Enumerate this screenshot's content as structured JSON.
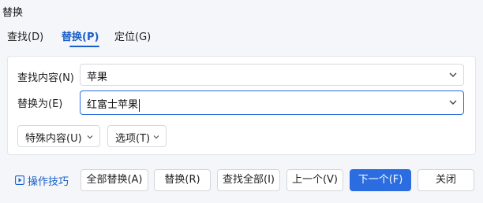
{
  "window": {
    "title": "替换"
  },
  "tabs": [
    {
      "label": "查找(D)",
      "active": false
    },
    {
      "label": "替换(P)",
      "active": true
    },
    {
      "label": "定位(G)",
      "active": false
    }
  ],
  "form": {
    "find_label": "查找内容(N)",
    "find_value": "苹果",
    "replace_label": "替换为(E)",
    "replace_value": "红富士苹果"
  },
  "dropdowns": {
    "special_label": "特殊内容(U)",
    "options_label": "选项(T)"
  },
  "footer": {
    "tips_label": "操作技巧",
    "tips_icon": "play-icon",
    "buttons": {
      "replace_all": "全部替换(A)",
      "replace": "替换(R)",
      "find_all": "查找全部(I)",
      "prev": "上一个(V)",
      "next": "下一个(F)",
      "close": "关闭"
    }
  },
  "colors": {
    "accent": "#2b6de0",
    "active_tab": "#1a5fc9",
    "background": "#f4f6f9"
  }
}
